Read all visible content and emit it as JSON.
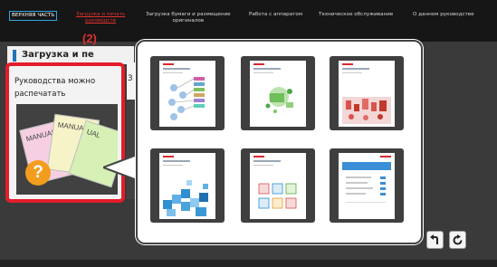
{
  "top_nav": {
    "items": [
      {
        "label": "ВЕРХНЯЯ ЧАСТЬ"
      },
      {
        "label_line1": "Загрузка и печать",
        "label_line2": "руководств"
      },
      {
        "label_line1": "Загрузка бумаги и размещение",
        "label_line2": "оригиналов"
      },
      {
        "label": "Работа с аппаратом"
      },
      {
        "label": "Техническое обслуживание"
      },
      {
        "label": "О данном руководстве"
      }
    ]
  },
  "section": {
    "heading": "Загрузка и пе"
  },
  "callout": "(2)",
  "card": {
    "label": "Руководства можно распечатать",
    "image_words": [
      "MANUAL",
      "MANUAL",
      "UAL"
    ],
    "question_mark": "?"
  },
  "ghost_card_char": "З",
  "colors": {
    "highlight_red": "#e31d2b",
    "brand_blue": "#1e76b8",
    "question_orange": "#f39d1e",
    "nav_active_red": "#e0322e"
  },
  "popup": {
    "thumbnails": [
      {
        "name": "manual-thumbnail-1",
        "illustration": "flowchart-diagram"
      },
      {
        "name": "manual-thumbnail-2",
        "illustration": "green-machine-parts"
      },
      {
        "name": "manual-thumbnail-3",
        "illustration": "red-city-graphic"
      },
      {
        "name": "manual-thumbnail-4",
        "illustration": "blue-pixel-blocks"
      },
      {
        "name": "manual-thumbnail-5",
        "illustration": "screen-icons-grid"
      },
      {
        "name": "manual-thumbnail-6",
        "illustration": "blue-screen-form"
      }
    ]
  },
  "controls": {
    "back_icon": "back-arrow-icon",
    "refresh_icon": "refresh-icon"
  }
}
